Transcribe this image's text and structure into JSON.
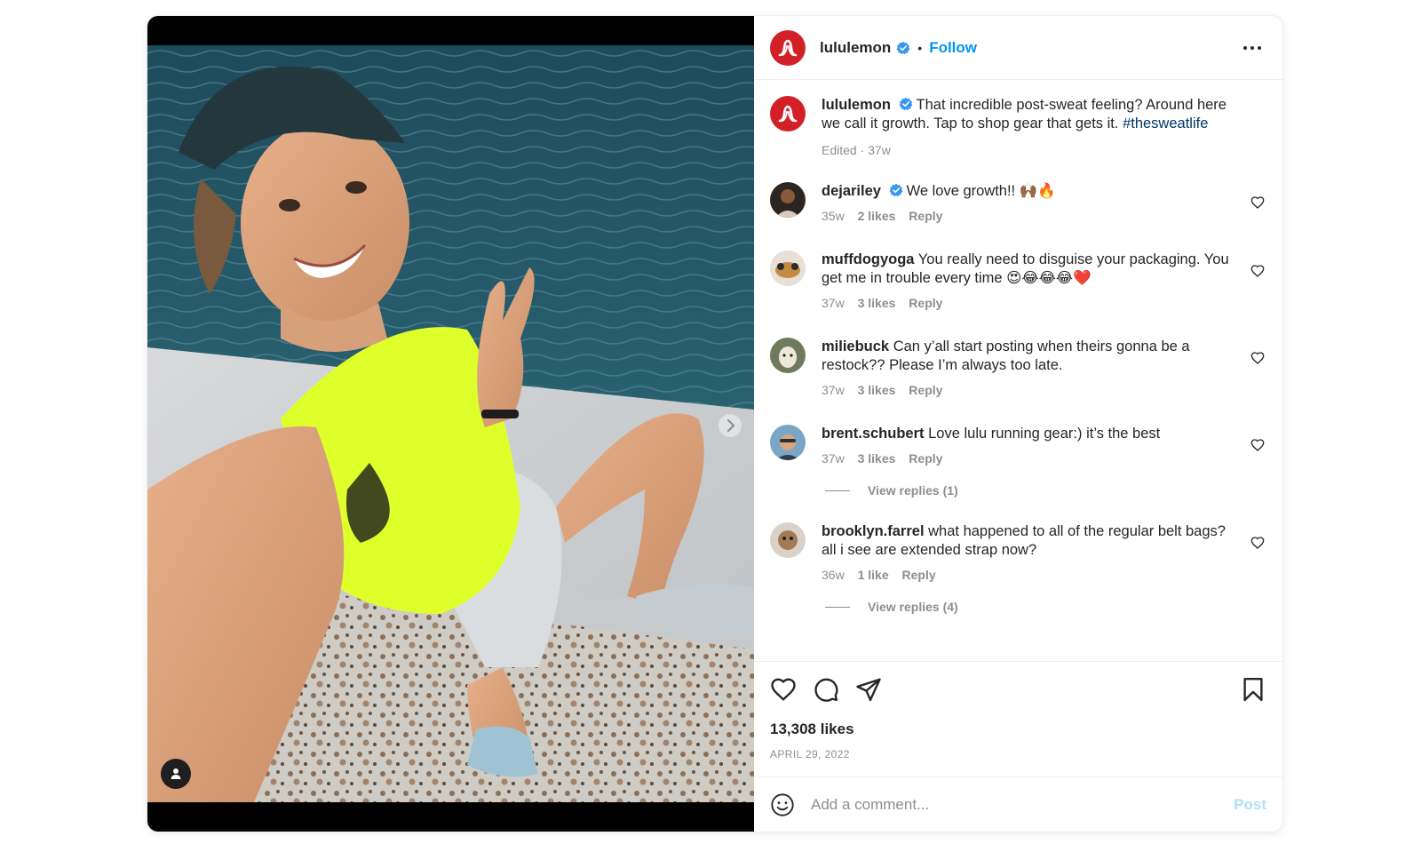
{
  "post": {
    "author": "lululemon",
    "follow_label": "Follow",
    "dot": "•",
    "caption": "That incredible post-sweat feeling? Around here we call it growth. Tap to shop gear that gets it.",
    "hashtag": "#thesweatlife",
    "caption_meta": "Edited · 37w",
    "likes": "13,308 likes",
    "date": "APRIL 29, 2022",
    "brand_color": "#d31f26",
    "accent_color": "#0095f6"
  },
  "comments": [
    {
      "user": "dejariley",
      "verified": true,
      "text": "We love growth!! 🙌🏾🔥",
      "age": "35w",
      "likes": "2 likes",
      "reply": "Reply"
    },
    {
      "user": "muffdogyoga",
      "verified": false,
      "text": "You really need to disguise your packaging. You get me in trouble every time 😍😂😂😂❤️",
      "age": "37w",
      "likes": "3 likes",
      "reply": "Reply"
    },
    {
      "user": "miliebuck",
      "verified": false,
      "text": "Can y’all start posting when theirs gonna be a restock?? Please I’m always too late.",
      "age": "37w",
      "likes": "3 likes",
      "reply": "Reply"
    },
    {
      "user": "brent.schubert",
      "verified": false,
      "text": "Love lulu running gear:) it’s the best",
      "age": "37w",
      "likes": "3 likes",
      "reply": "Reply",
      "view_replies": "View replies (1)"
    },
    {
      "user": "brooklyn.farrel",
      "verified": false,
      "text": "what happened to all of the regular belt bags? all i see are extended strap now?",
      "age": "36w",
      "likes": "1 like",
      "reply": "Reply",
      "view_replies": "View replies (4)"
    }
  ],
  "composer": {
    "placeholder": "Add a comment...",
    "post_label": "Post"
  },
  "icons": {
    "like": "heart-icon",
    "comment": "comment-icon",
    "share": "share-icon",
    "save": "bookmark-icon",
    "emoji": "emoji-icon",
    "more": "more-icon",
    "tag": "user-tag-icon",
    "next": "chevron-right-icon"
  }
}
